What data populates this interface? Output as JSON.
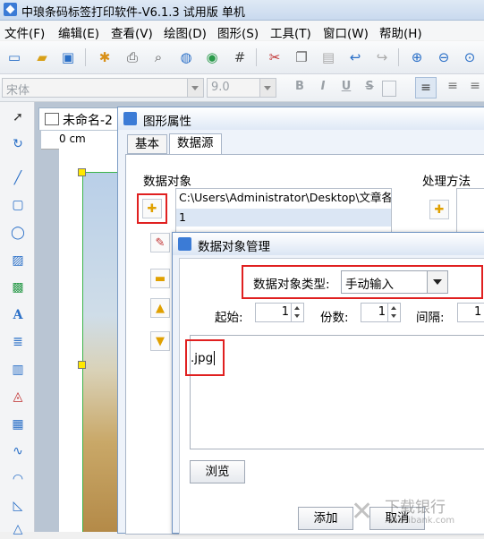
{
  "app": {
    "title": "中琅条码标签打印软件-V6.1.3 试用版 单机"
  },
  "menu": [
    "文件(F)",
    "编辑(E)",
    "查看(V)",
    "绘图(D)",
    "图形(S)",
    "工具(T)",
    "窗口(W)",
    "帮助(H)"
  ],
  "format_bar": {
    "font_name": "宋体",
    "font_size": "9.0",
    "bold": "B",
    "italic": "I",
    "underline": "U",
    "strike": "S"
  },
  "document": {
    "tab_title": "未命名-2",
    "ruler_label": "0 cm"
  },
  "graphic_props": {
    "title": "图形属性",
    "tabs": [
      "基本",
      "数据源"
    ],
    "data_object_label": "数据对象",
    "processing_label": "处理方法",
    "data_rows": [
      "C:\\Users\\Administrator\\Desktop\\文章各",
      "1"
    ]
  },
  "data_mgmt": {
    "title": "数据对象管理",
    "type_label": "数据对象类型:",
    "type_value": "手动输入",
    "start_label": "起始:",
    "start_value": "1",
    "copies_label": "份数:",
    "copies_value": "1",
    "interval_label": "间隔:",
    "interval_value": "1",
    "text_content": ".jpg",
    "browse_label": "浏览",
    "add_label": "添加",
    "cancel_label": "取消"
  },
  "watermark": {
    "text": "下载银行",
    "sub": "xiazaibank.com"
  },
  "colors": {
    "highlight_red": "#e02020",
    "list_selection": "#dbe6f4"
  }
}
